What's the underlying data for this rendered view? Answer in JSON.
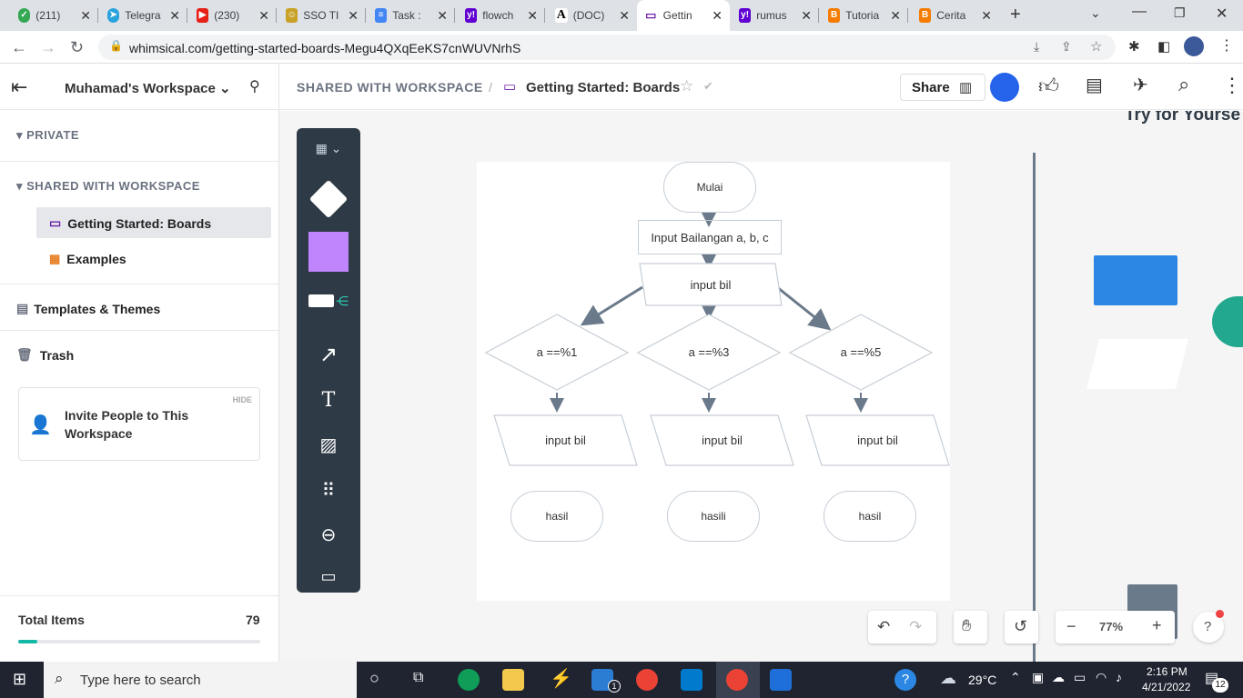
{
  "browser": {
    "tabs": [
      {
        "title": "(211)",
        "color": "#34a853",
        "icon": "whatsapp-icon"
      },
      {
        "title": "Telegra",
        "color": "#2aa3dd",
        "icon": "telegram-icon"
      },
      {
        "title": "(230)",
        "color": "#e62117",
        "icon": "youtube-icon"
      },
      {
        "title": "SSO TI",
        "color": "#c9a227",
        "icon": "sso-icon"
      },
      {
        "title": "Task :",
        "color": "#4285f4",
        "icon": "docs-icon"
      },
      {
        "title": "flowch",
        "color": "#6001d2",
        "icon": "yahoo-icon"
      },
      {
        "title": "(DOC)",
        "color": "#ffffff",
        "icon": "academia-icon"
      },
      {
        "title": "Gettin",
        "color": "#6b21a8",
        "icon": "whimsical-icon"
      },
      {
        "title": "rumus",
        "color": "#6001d2",
        "icon": "yahoo-icon"
      },
      {
        "title": "Tutoria",
        "color": "#f57c00",
        "icon": "blogger-icon"
      },
      {
        "title": "Cerita",
        "color": "#f57c00",
        "icon": "blogger-icon"
      }
    ],
    "url": "whimsical.com/getting-started-boards-Megu4QXqEeKS7cnWUVNrhS"
  },
  "sidebar": {
    "workspace": "Muhamad's Workspace",
    "private_label": "PRIVATE",
    "shared_label": "SHARED WITH WORKSPACE",
    "items": [
      {
        "label": "Getting Started: Boards"
      },
      {
        "label": "Examples"
      }
    ],
    "templates": "Templates & Themes",
    "trash": "Trash",
    "invite_hide": "HIDE",
    "invite_text": "Invite People to This Workspace",
    "total_label": "Total Items",
    "total_value": "79",
    "total_progress": 0.08
  },
  "topbar": {
    "breadcrumb_root": "SHARED WITH WORKSPACE",
    "breadcrumb_sep": "/",
    "title": "Getting Started: Boards",
    "share": "Share"
  },
  "canvas": {
    "side_text": "Try for Yourse",
    "zoom": "77%",
    "help": "?"
  },
  "flowchart": {
    "start": "Mulai",
    "input1": "Input Bailangan a, b, c",
    "input2": "input bil",
    "cond1": "a ==%1",
    "cond2": "a ==%3",
    "cond3": "a ==%5",
    "out1": "input bil",
    "out2": "input bil",
    "out3": "input bil",
    "end1": "hasil",
    "end2": "hasili",
    "end3": "hasil"
  },
  "taskbar": {
    "search": "Type here to search",
    "temp": "29°C",
    "time": "2:16 PM",
    "date": "4/21/2022",
    "mail_badge": "1",
    "notif_badge": "12"
  }
}
